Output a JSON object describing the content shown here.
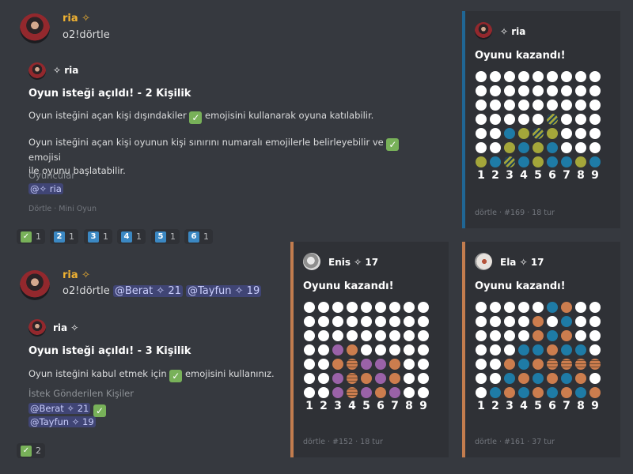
{
  "msg1": {
    "username": "ria ✧",
    "content": "o2!dörtle",
    "embed": {
      "author": "✧ ria",
      "title": "Oyun isteği açıldı! - 2 Kişilik",
      "desc1a": "Oyun isteğini açan kişi dışındakiler",
      "desc1b": "emojisini kullanarak oyuna katılabilir.",
      "desc2a": "Oyun isteğini açan kişi oyunun kişi sınırını numaralı emojilerle belirleyebilir ve",
      "desc2b": "emojisi",
      "desc2c": "ile oyunu başlatabilir.",
      "field_name": "Oyuncular",
      "field_value": "@✧ ria",
      "footer": "Dörtle · Mini Oyun"
    },
    "reactions": [
      {
        "emoji": "✓",
        "kind": "check",
        "count": "1"
      },
      {
        "emoji": "2",
        "kind": "num",
        "count": "1"
      },
      {
        "emoji": "3",
        "kind": "num",
        "count": "1"
      },
      {
        "emoji": "4",
        "kind": "num",
        "count": "1"
      },
      {
        "emoji": "5",
        "kind": "num",
        "count": "1"
      },
      {
        "emoji": "6",
        "kind": "num",
        "count": "1"
      }
    ]
  },
  "msg2": {
    "username": "ria ✧",
    "content": "o2!dörtle",
    "mention1": "@Berat ✧ 21",
    "mention2": "@Tayfun ✧ 19",
    "embed": {
      "author": "ria ✧",
      "title": "Oyun isteği açıldı! - 3 Kişilik",
      "desc_a": "Oyun isteğini kabul etmek için",
      "desc_b": "emojisini kullanınız.",
      "field_name": "İstek Gönderilen Kişiler",
      "field_v1": "@Berat ✧ 21",
      "field_v2": "@Tayfun ✧ 19"
    },
    "reaction": {
      "emoji": "✓",
      "count": "2"
    }
  },
  "games": [
    {
      "author": "✧ ria",
      "title": "Oyunu kazandı!",
      "footer": "dörtle · #169 · 18 tur",
      "border": "#206694",
      "board": [
        "WWWWWWWWW",
        "WWWWWWWWW",
        "WWWWWWWWW",
        "WWWWWxWWW",
        "WWByxyWWW",
        "WWyByBWWW",
        "yBxByBByB"
      ]
    },
    {
      "author": "Enis ✧ 17",
      "title": "Oyunu kazandı!",
      "footer": "dörtle · #152 · 18 tur",
      "border": "#c27c4e",
      "board": [
        "WWWWWWWWW",
        "WWWWWWWWW",
        "WWWWWWWWW",
        "WWPOWWWWW",
        "WWOzPPOWW",
        "WWPzOPOWW",
        "WWPzPOPWW"
      ]
    },
    {
      "author": "Ela ✧ 17",
      "title": "Oyunu kazandı!",
      "footer": "dörtle · #161 · 37 tur",
      "border": "#c27c4e",
      "board": [
        "WWWWWBOWW",
        "WWWWOWBWW",
        "WWWWOBOWW",
        "WWWBBOBBW",
        "WWOBOzzzz",
        "WWBOBOBOW",
        "WBOBOBOBO"
      ]
    }
  ],
  "column_labels": [
    "1",
    "2",
    "3",
    "4",
    "5",
    "6",
    "7",
    "8",
    "9"
  ],
  "colors": {
    "white": "#ffffff",
    "olive": "#a4a63a",
    "blue": "#1e7ba6",
    "orange": "#cc7d4e",
    "purple": "#9a62a8",
    "stripe": "#1e3f5a",
    "stripe2": "#6b4a32"
  }
}
